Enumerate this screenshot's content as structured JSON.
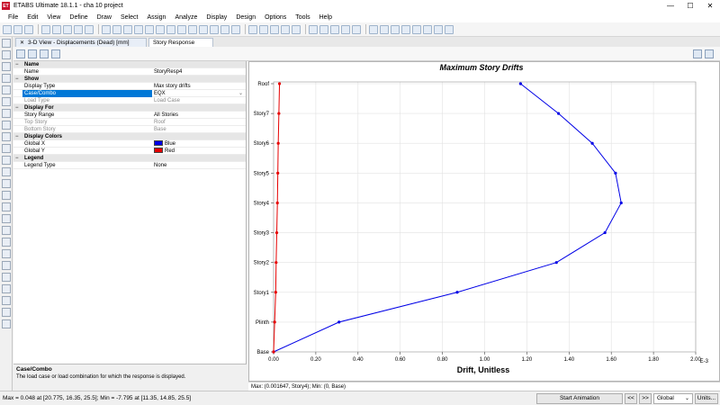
{
  "window": {
    "app_icon_text": "ET",
    "title": "ETABS Ultimate 18.1.1 - cha 10 project",
    "minimize": "—",
    "maximize": "☐",
    "close": "✕"
  },
  "menu": [
    "File",
    "Edit",
    "View",
    "Define",
    "Draw",
    "Select",
    "Assign",
    "Analyze",
    "Display",
    "Design",
    "Options",
    "Tools",
    "Help"
  ],
  "tabs": {
    "tab1_close": "✕",
    "tab1": "3-D View  - Displacements (Dead)  [mm]",
    "tab2": "Story Response"
  },
  "properties": {
    "name_cat": "Name",
    "name_label": "Name",
    "name_value": "StoryResp4",
    "show_cat": "Show",
    "display_type_label": "Display Type",
    "display_type_value": "Max story drifts",
    "case_combo_label": "Case/Combo",
    "case_combo_value": "EQX",
    "load_type_label": "Load Type",
    "load_type_value": "Load Case",
    "display_for_cat": "Display For",
    "story_range_label": "Story Range",
    "story_range_value": "All Stories",
    "top_story_label": "Top Story",
    "top_story_value": "Roof",
    "bottom_story_label": "Bottom Story",
    "bottom_story_value": "Base",
    "display_colors_cat": "Display Colors",
    "global_x_label": "Global X",
    "global_x_value": "Blue",
    "global_y_label": "Global Y",
    "global_y_value": "Red",
    "legend_cat": "Legend",
    "legend_type_label": "Legend Type",
    "legend_type_value": "None"
  },
  "help": {
    "title": "Case/Combo",
    "text": "The load case or load combination for which the response is displayed."
  },
  "colors": {
    "global_x": "#0000e6",
    "global_y": "#e60000",
    "selection": "#0078d7"
  },
  "chart_data": {
    "type": "line",
    "title": "Maximum Story Drifts",
    "xlabel": "Drift, Unitless",
    "x_axis_unit": "E-3",
    "xlim": [
      0,
      2.0
    ],
    "x_ticks": [
      "0.00",
      "0.20",
      "0.40",
      "0.60",
      "0.80",
      "1.00",
      "1.20",
      "1.40",
      "1.60",
      "1.80",
      "2.00"
    ],
    "stories": [
      "Base",
      "Plinth",
      "Story1",
      "Story2",
      "Story3",
      "Story4",
      "Story5",
      "Story6",
      "Story7",
      "Roof"
    ],
    "series": [
      {
        "name": "Global X",
        "color": "#0000e6",
        "values": [
          0,
          0.31,
          0.87,
          1.34,
          1.57,
          1.647,
          1.62,
          1.51,
          1.35,
          1.17
        ]
      },
      {
        "name": "Global Y",
        "color": "#e60000",
        "values": [
          0,
          0.005,
          0.01,
          0.012,
          0.015,
          0.018,
          0.02,
          0.022,
          0.025,
          0.028
        ]
      }
    ],
    "grid": true
  },
  "minmax_text": "Max: (0.001647, Story4);  Min: (0, Base)",
  "status": {
    "text": "Max = 0.048 at [20.775, 16.35, 25.5];  Min = -7.795 at [11.35, 14.85, 25.5]",
    "start_animation": "Start Animation",
    "prev": "<<",
    "next": ">>",
    "coord_system": "Global",
    "units": "Units..."
  }
}
